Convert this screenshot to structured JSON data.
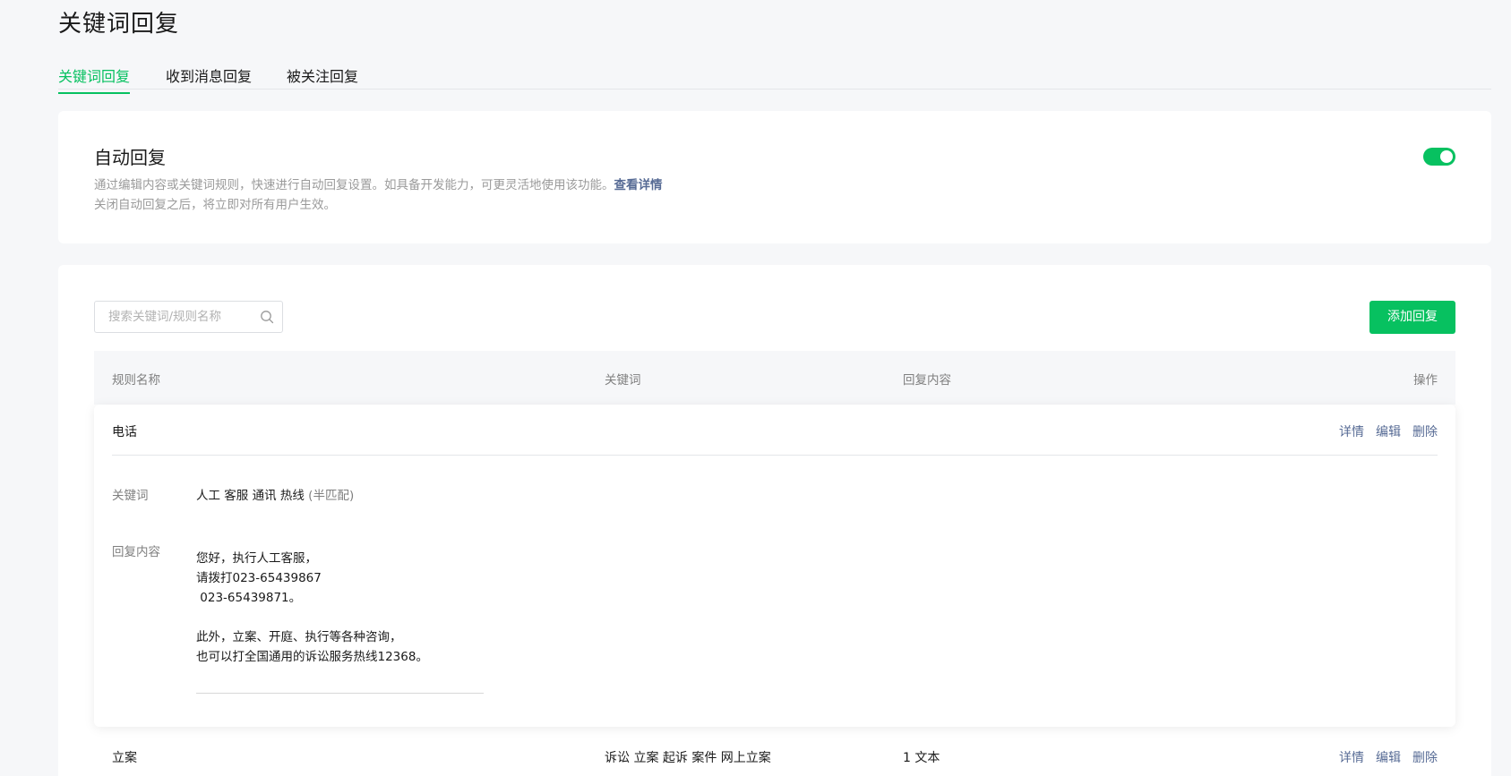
{
  "page": {
    "title": "关键词回复"
  },
  "tabs": [
    {
      "label": "关键词回复",
      "active": true
    },
    {
      "label": "收到消息回复",
      "active": false
    },
    {
      "label": "被关注回复",
      "active": false
    }
  ],
  "auto_reply": {
    "title": "自动回复",
    "desc_line1": "通过编辑内容或关键词规则，快速进行自动回复设置。如具备开发能力，可更灵活地使用该功能。",
    "details_link": "查看详情",
    "desc_line2": "关闭自动回复之后，将立即对所有用户生效。",
    "enabled": true
  },
  "list": {
    "search_placeholder": "搜索关键词/规则名称",
    "add_button": "添加回复",
    "columns": {
      "name": "规则名称",
      "keywords": "关键词",
      "content": "回复内容",
      "actions": "操作"
    },
    "actions": {
      "details": "详情",
      "edit": "编辑",
      "delete": "删除"
    },
    "expanded_rule": {
      "name": "电话",
      "keyword_label": "关键词",
      "keywords": "人工 客服 通讯 热线",
      "match_mode": "(半匹配)",
      "content_label": "回复内容",
      "content_lines": [
        "您好，执行人工客服，",
        "请拨打023-65439867",
        " 023-65439871。",
        "",
        "此外，立案、开庭、执行等各种咨询，",
        "也可以打全国通用的诉讼服务热线12368。"
      ]
    },
    "rows": [
      {
        "name": "立案",
        "keywords": "诉讼 立案 起诉 案件 网上立案",
        "content": "1 文本"
      }
    ]
  },
  "colors": {
    "accent": "#07c160",
    "link": "#576b95",
    "muted": "#9a9a9a"
  }
}
